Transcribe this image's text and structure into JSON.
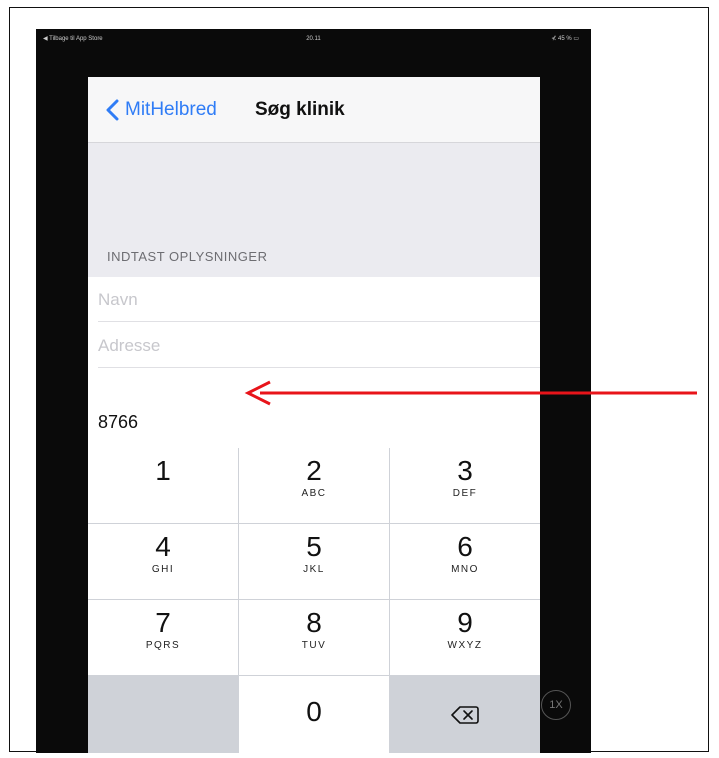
{
  "status_bar": {
    "left": "◀ Tilbage til App Store",
    "time": "20.11",
    "right": "⊀ 45 % ▭"
  },
  "nav": {
    "back_label": "MitHelbred",
    "title": "Søg klinik"
  },
  "form": {
    "section_header": "INDTAST OPLYSNINGER",
    "name_placeholder": "Navn",
    "address_placeholder": "Adresse",
    "zip_value": "8766"
  },
  "keypad": {
    "keys": [
      {
        "digit": "1",
        "letters": ""
      },
      {
        "digit": "2",
        "letters": "ABC"
      },
      {
        "digit": "3",
        "letters": "DEF"
      },
      {
        "digit": "4",
        "letters": "GHI"
      },
      {
        "digit": "5",
        "letters": "JKL"
      },
      {
        "digit": "6",
        "letters": "MNO"
      },
      {
        "digit": "7",
        "letters": "PQRS"
      },
      {
        "digit": "8",
        "letters": "TUV"
      },
      {
        "digit": "9",
        "letters": "WXYZ"
      },
      {
        "digit": "0",
        "letters": ""
      }
    ]
  },
  "scale_badge": "1X",
  "colors": {
    "accent": "#2f7cf6",
    "annotation": "#e8141a",
    "keypad_background": "#cfd2d8"
  }
}
